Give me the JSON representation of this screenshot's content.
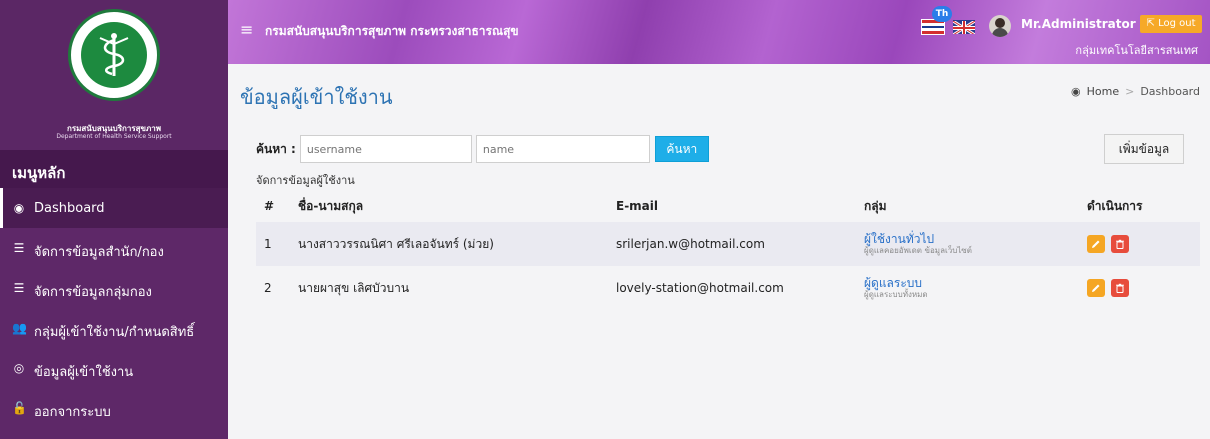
{
  "sidebar": {
    "logo_ring_text": "กระทรวงสาธารณสุข",
    "logo_ring_bottom": "MINISTRY OF PUBLIC HEALTH",
    "dept_name": "กรมสนับสนุนบริการสุขภาพ",
    "dept_name_en": "Department of Health Service Support",
    "menu_title": "เมนูหลัก",
    "items": [
      {
        "label": "Dashboard",
        "icon": "dashboard-icon"
      },
      {
        "label": "จัดการข้อมูลสำนัก/กอง",
        "icon": "list-icon"
      },
      {
        "label": "จัดการข้อมูลกลุ่มกอง",
        "icon": "list-icon"
      },
      {
        "label": "กลุ่มผู้เข้าใช้งาน/กำหนดสิทธิ์",
        "icon": "users-icon"
      },
      {
        "label": "ข้อมูลผู้เข้าใช้งาน",
        "icon": "user-circle-icon"
      },
      {
        "label": "ออกจากระบบ",
        "icon": "unlock-icon"
      }
    ]
  },
  "topbar": {
    "org_title": "กรมสนับสนุนบริการสุขภาพ กระทรวงสาธารณสุข",
    "lang_badge": "Th",
    "user_name": "Mr.Administrator",
    "logout_label": "Log out",
    "user_group": "กลุ่มเทคโนโลยีสารสนเทศ"
  },
  "page": {
    "title": "ข้อมูลผู้เข้าใช้งาน",
    "breadcrumb_home": "Home",
    "breadcrumb_current": "Dashboard"
  },
  "search": {
    "label": "ค้นหา :",
    "username_placeholder": "username",
    "name_placeholder": "name",
    "button_label": "ค้นหา",
    "add_label": "เพิ่มข้อมูล"
  },
  "table": {
    "caption": "จัดการข้อมูลผู้ใช้งาน",
    "headers": {
      "num": "#",
      "name": "ชื่อ-นามสกุล",
      "email": "E-mail",
      "group": "กลุ่ม",
      "action": "ดำเนินการ"
    },
    "rows": [
      {
        "num": "1",
        "name": "นางสาววรรณนิศา ศรีเลอจันทร์ (ม่วย)",
        "email": "srilerjan.w@hotmail.com",
        "group": "ผู้ใช้งานทั่วไป",
        "group_desc": "ผู้ดูแลคอยอัพเดต ข้อมูลเว็บไซต์"
      },
      {
        "num": "2",
        "name": "นายผาสุข เลิศบัวบาน",
        "email": "lovely-station@hotmail.com",
        "group": "ผู้ดูแลระบบ",
        "group_desc": "ผู้ดูแลระบบทั้งหมด"
      }
    ]
  },
  "colors": {
    "sidebar": "#5e2868",
    "accent_blue": "#1eaee8",
    "edit": "#f5a623",
    "delete": "#e74c3c",
    "title_blue": "#2d73b3"
  }
}
